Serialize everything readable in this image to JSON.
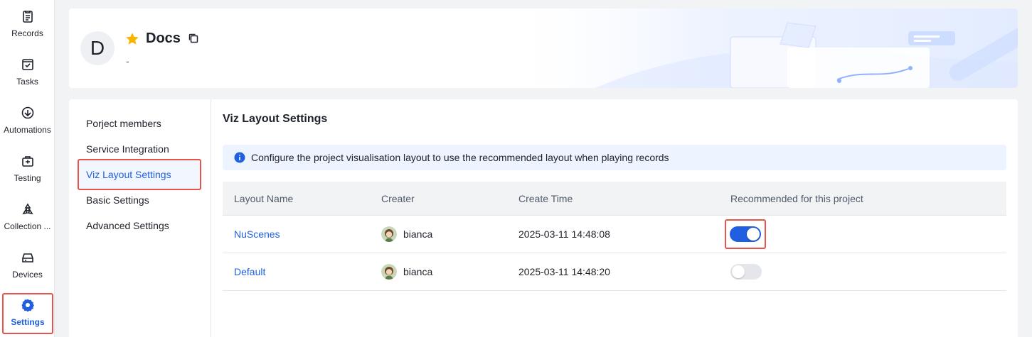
{
  "sidebar": {
    "items": [
      {
        "label": "Records",
        "icon": "records-icon"
      },
      {
        "label": "Tasks",
        "icon": "tasks-icon"
      },
      {
        "label": "Automations",
        "icon": "automations-icon"
      },
      {
        "label": "Testing",
        "icon": "testing-icon"
      },
      {
        "label": "Collection ...",
        "icon": "collection-icon"
      },
      {
        "label": "Devices",
        "icon": "devices-icon"
      },
      {
        "label": "Settings",
        "icon": "settings-gear-icon",
        "active": true
      }
    ]
  },
  "project": {
    "avatar_letter": "D",
    "name": "Docs",
    "description": "-",
    "starred": true
  },
  "settings_nav": {
    "items": [
      {
        "label": "Porject members"
      },
      {
        "label": "Service Integration"
      },
      {
        "label": "Viz Layout Settings",
        "active": true
      },
      {
        "label": "Basic Settings"
      },
      {
        "label": "Advanced Settings"
      }
    ]
  },
  "content": {
    "title": "Viz Layout Settings",
    "info": "Configure the project visualisation layout to use the recommended layout when playing records"
  },
  "table": {
    "columns": [
      "Layout Name",
      "Creater",
      "Create Time",
      "Recommended for this project"
    ],
    "rows": [
      {
        "name": "NuScenes",
        "creator": "bianca",
        "created": "2025-03-11 14:48:08",
        "recommended": true
      },
      {
        "name": "Default",
        "creator": "bianca",
        "created": "2025-03-11 14:48:20",
        "recommended": false
      }
    ]
  },
  "colors": {
    "accent": "#1f5fe0",
    "highlight_border": "#e5534b",
    "star": "#f7b500"
  }
}
